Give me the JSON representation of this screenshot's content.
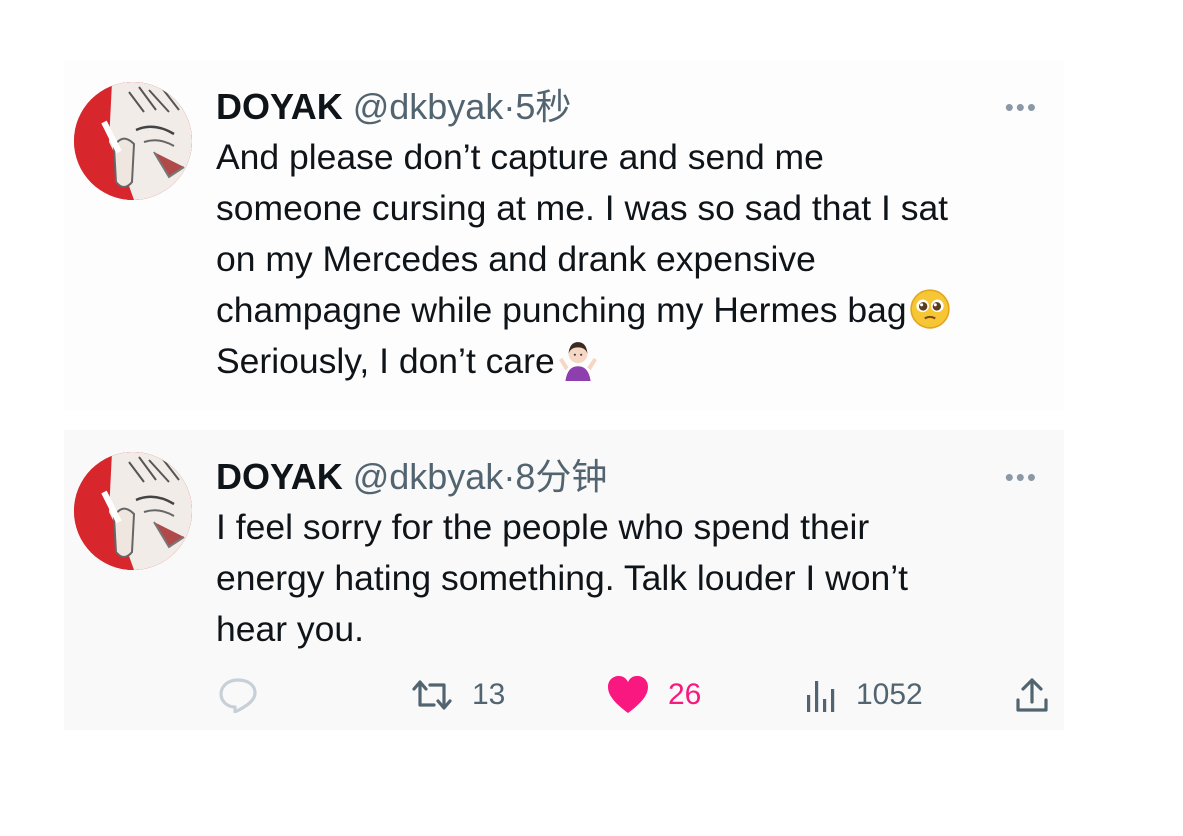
{
  "tweets": [
    {
      "name": "DOYAK",
      "handle": "@dkbyak",
      "separator": "·",
      "time": "5秒",
      "more_icon": "more-horizontal-icon",
      "lines": [
        "And please don’t capture and send me",
        "someone cursing at me. I was so sad that I sat",
        "on my Mercedes and drank expensive",
        "champagne while punching my Hermes bag",
        "Seriously, I don’t care"
      ],
      "emojis": [
        "pleading-face-emoji",
        "person-shrugging-emoji"
      ]
    },
    {
      "name": "DOYAK",
      "handle": "@dkbyak",
      "separator": "·",
      "time": "8分钟",
      "more_icon": "more-horizontal-icon",
      "lines": [
        "I feel sorry for the people who spend their",
        "energy hating something. Talk louder I won’t",
        "hear you."
      ],
      "actions": {
        "reply_icon": "reply-icon",
        "retweet_icon": "retweet-icon",
        "retweets": "13",
        "like_icon": "heart-icon",
        "likes": "26",
        "views_icon": "views-icon",
        "views": "1052",
        "share_icon": "share-icon"
      }
    }
  ],
  "colors": {
    "text": "#0f1419",
    "secondary": "#536471",
    "like": "#f91880",
    "avatar_accent": "#d7262c"
  }
}
